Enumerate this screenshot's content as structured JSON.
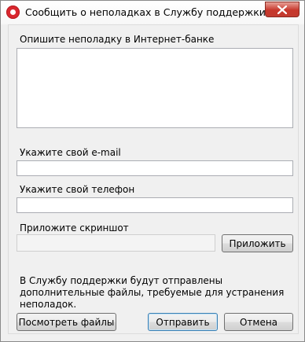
{
  "window": {
    "title": "Сообщить о неполадках в Службу поддержки",
    "icon": "app-logo-icon",
    "close_icon": "close-icon"
  },
  "form": {
    "description_label": "Опишите неполадку в Интернет-банке",
    "description_value": "",
    "email_label": "Укажите свой e-mail",
    "email_value": "",
    "phone_label": "Укажите свой телефон",
    "phone_value": "",
    "screenshot_label": "Приложите скриншот",
    "screenshot_path": "",
    "attach_button": "Приложить",
    "notice": "В Службу поддержки будут отправлены дополнительные файлы, требуемые для устранения неполадок."
  },
  "footer": {
    "view_files_button": "Посмотреть файлы",
    "send_button": "Отправить",
    "cancel_button": "Отмена"
  },
  "colors": {
    "close_button": "#c7372c",
    "default_button_border": "#3c7fb1",
    "app_icon": "#d9272e"
  }
}
